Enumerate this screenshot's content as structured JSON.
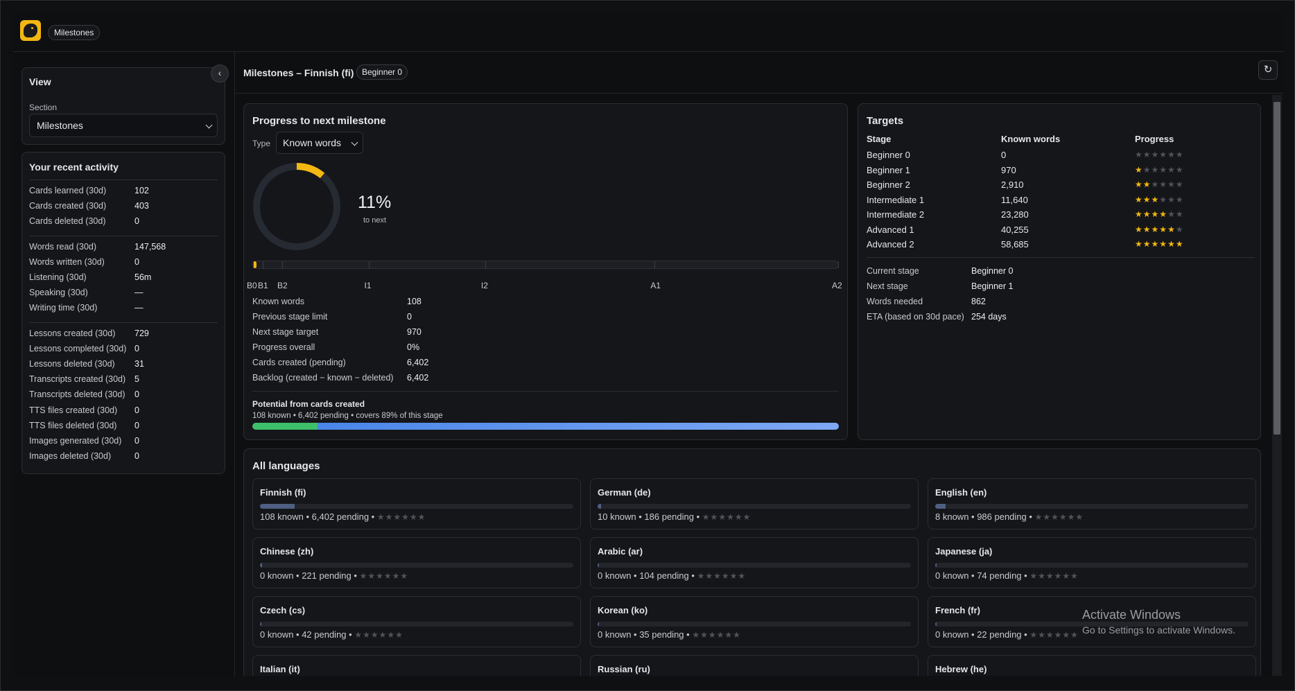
{
  "topbar": {
    "chip_label": "Milestones"
  },
  "sidebar": {
    "view_title": "View",
    "section_label": "Section",
    "section_value": "Milestones",
    "activity_title": "Your recent activity",
    "groups": [
      [
        {
          "label": "Cards learned (30d)",
          "value": "102"
        },
        {
          "label": "Cards created (30d)",
          "value": "403"
        },
        {
          "label": "Cards deleted (30d)",
          "value": "0"
        }
      ],
      [
        {
          "label": "Words read (30d)",
          "value": "147,568"
        },
        {
          "label": "Words written (30d)",
          "value": "0"
        },
        {
          "label": "Listening (30d)",
          "value": "56m"
        },
        {
          "label": "Speaking (30d)",
          "value": "—"
        },
        {
          "label": "Writing time (30d)",
          "value": "—"
        }
      ],
      [
        {
          "label": "Lessons created (30d)",
          "value": "729"
        },
        {
          "label": "Lessons completed (30d)",
          "value": "0"
        },
        {
          "label": "Lessons deleted (30d)",
          "value": "31"
        },
        {
          "label": "Transcripts created (30d)",
          "value": "5"
        },
        {
          "label": "Transcripts deleted (30d)",
          "value": "0"
        },
        {
          "label": "TTS files created (30d)",
          "value": "0"
        },
        {
          "label": "TTS files deleted (30d)",
          "value": "0"
        },
        {
          "label": "Images generated (30d)",
          "value": "0"
        },
        {
          "label": "Images deleted (30d)",
          "value": "0"
        }
      ]
    ]
  },
  "main": {
    "title": "Milestones – Finnish (fi)",
    "stage_chip": "Beginner 0",
    "progress": {
      "title": "Progress to next milestone",
      "type_label": "Type",
      "type_value": "Known words",
      "percent_label": "11%",
      "percent_value": 0.11,
      "to_next": "to next",
      "track_fill": 0.002,
      "ticks": [
        {
          "label": "B0",
          "pos": 0
        },
        {
          "label": "B1",
          "pos": 0.0165
        },
        {
          "label": "B2",
          "pos": 0.0496
        },
        {
          "label": "I1",
          "pos": 0.198
        },
        {
          "label": "I2",
          "pos": 0.397
        },
        {
          "label": "A1",
          "pos": 0.686
        },
        {
          "label": "A2",
          "pos": 1
        }
      ],
      "stats": [
        {
          "label": "Known words",
          "value": "108"
        },
        {
          "label": "Previous stage limit",
          "value": "0"
        },
        {
          "label": "Next stage target",
          "value": "970"
        },
        {
          "label": "Progress overall",
          "value": "0%"
        },
        {
          "label": "Cards created (pending)",
          "value": "6,402"
        },
        {
          "label": "Backlog (created − known − deleted)",
          "value": "6,402"
        }
      ],
      "potential_title": "Potential from cards created",
      "potential_sub": "108 known • 6,402 pending • covers 89% of this stage",
      "potential_known_frac": 0.111,
      "potential_pending_frac": 0.889
    },
    "targets": {
      "title": "Targets",
      "headers": [
        "Stage",
        "Known words",
        "Progress"
      ],
      "rows": [
        {
          "stage": "Beginner 0",
          "words": "0",
          "stars": 0
        },
        {
          "stage": "Beginner 1",
          "words": "970",
          "stars": 1
        },
        {
          "stage": "Beginner 2",
          "words": "2,910",
          "stars": 2
        },
        {
          "stage": "Intermediate 1",
          "words": "11,640",
          "stars": 3
        },
        {
          "stage": "Intermediate 2",
          "words": "23,280",
          "stars": 4
        },
        {
          "stage": "Advanced 1",
          "words": "40,255",
          "stars": 5
        },
        {
          "stage": "Advanced 2",
          "words": "58,685",
          "stars": 6
        }
      ],
      "info": [
        {
          "label": "Current stage",
          "value": "Beginner 0"
        },
        {
          "label": "Next stage",
          "value": "Beginner 1"
        },
        {
          "label": "Words needed",
          "value": "862"
        },
        {
          "label": "ETA (based on 30d pace)",
          "value": "254 days"
        }
      ]
    },
    "languages": {
      "title": "All languages",
      "items": [
        {
          "name": "Finnish (fi)",
          "meta": "108 known • 6,402 pending •",
          "fill": 0.111
        },
        {
          "name": "German (de)",
          "meta": "10 known • 186 pending •",
          "fill": 0.01
        },
        {
          "name": "English (en)",
          "meta": "8 known • 986 pending •",
          "fill": 0.033
        },
        {
          "name": "Chinese (zh)",
          "meta": "0 known • 221 pending •",
          "fill": 0.006
        },
        {
          "name": "Arabic (ar)",
          "meta": "0 known • 104 pending •",
          "fill": 0.004
        },
        {
          "name": "Japanese (ja)",
          "meta": "0 known • 74 pending •",
          "fill": 0.003
        },
        {
          "name": "Czech (cs)",
          "meta": "0 known • 42 pending •",
          "fill": 0.002
        },
        {
          "name": "Korean (ko)",
          "meta": "0 known • 35 pending •",
          "fill": 0.002
        },
        {
          "name": "French (fr)",
          "meta": "0 known • 22 pending •",
          "fill": 0.002
        },
        {
          "name": "Italian (it)",
          "meta": "",
          "fill": 0
        },
        {
          "name": "Russian (ru)",
          "meta": "",
          "fill": 0
        },
        {
          "name": "Hebrew (he)",
          "meta": "",
          "fill": 0
        }
      ],
      "stars": "★★★★★★"
    }
  },
  "watermark": {
    "title": "Activate Windows",
    "sub": "Go to Settings to activate Windows."
  },
  "colors": {
    "accent": "#f3b712",
    "known": "#3ebf6a",
    "pending": "#4a86e8"
  },
  "icons": {
    "logo": "lion-logo-icon",
    "collapse": "chevron-left-icon",
    "refresh": "refresh-icon",
    "dropdown": "chevron-down-icon"
  }
}
